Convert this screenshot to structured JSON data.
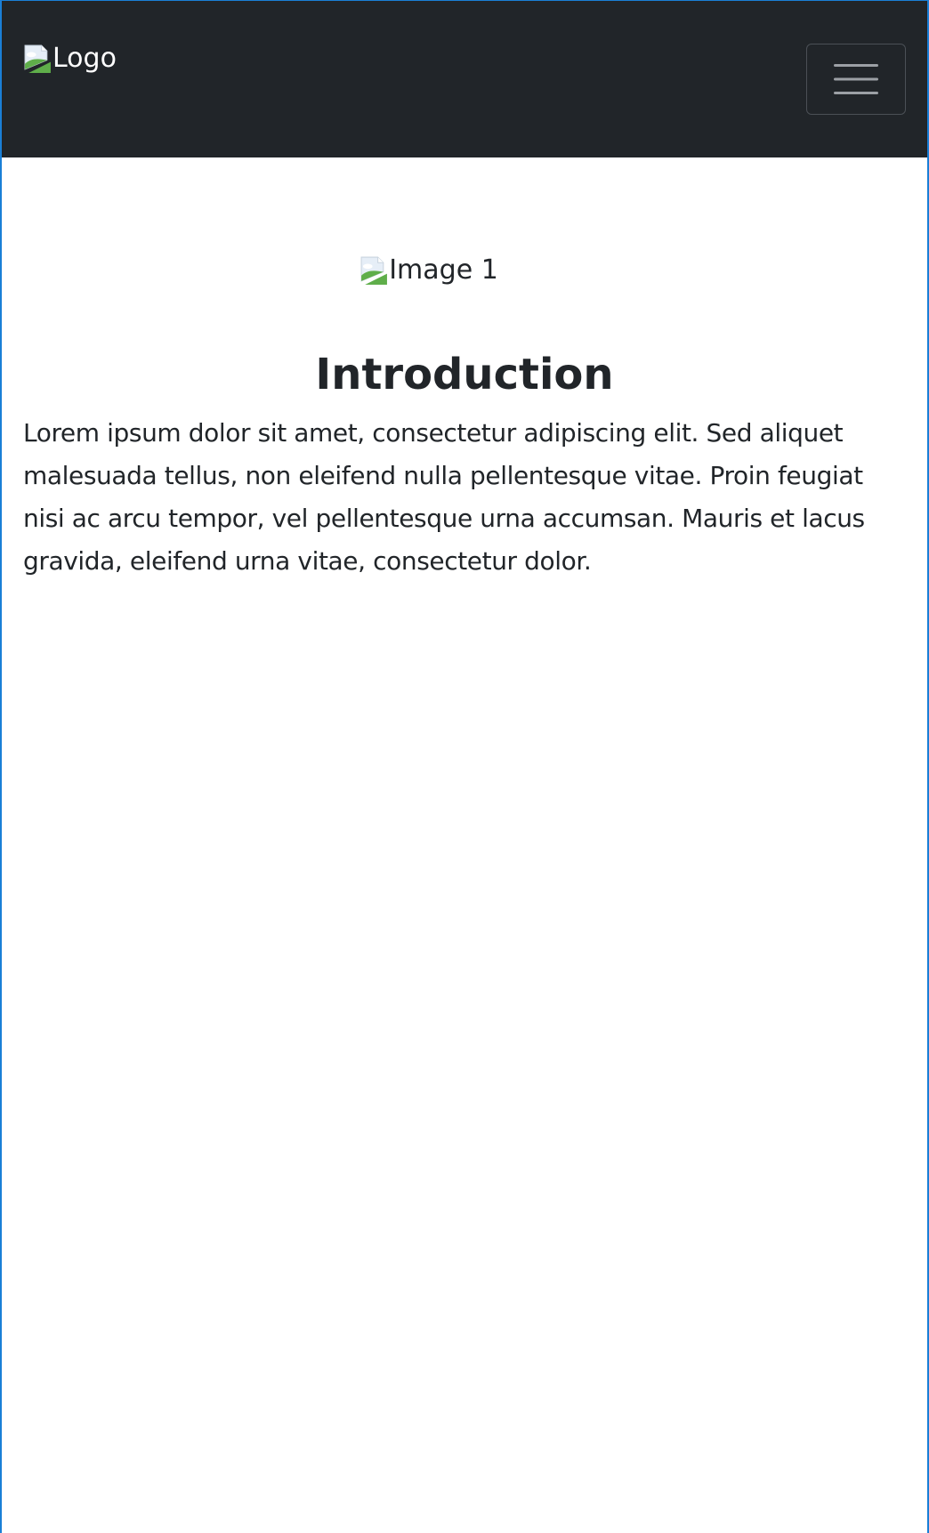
{
  "navbar": {
    "logo_alt": "Logo",
    "toggler_icon": "menu-icon"
  },
  "main": {
    "image_alt": "Image 1",
    "image_icon": "broken-image-icon",
    "heading": "Introduction",
    "paragraph": "Lorem ipsum dolor sit amet, consectetur adipiscing elit. Sed aliquet malesuada tellus, non eleifend nulla pellentesque vitae. Proin feugiat nisi ac arcu tempor, vel pellentesque urna accumsan. Mauris et lacus gravida, eleifend urna vitae, consectetur dolor."
  },
  "colors": {
    "navbar_bg": "#212529",
    "text": "#212529",
    "frame_accent": "#1a7fd6"
  }
}
